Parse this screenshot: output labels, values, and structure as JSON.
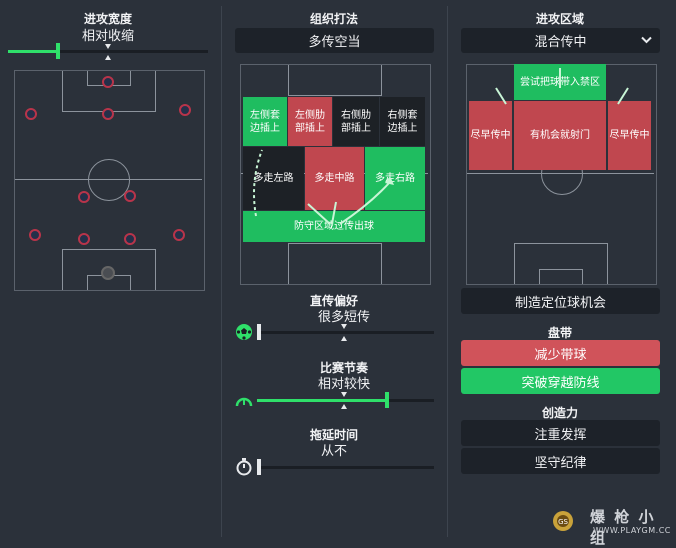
{
  "left": {
    "width_title": "进攻宽度",
    "width_value": "相对收缩",
    "width_level": 0.25
  },
  "mid": {
    "org_title": "组织打法",
    "org_value": "多传空当",
    "zones": {
      "top_left": "左侧套\n边插上",
      "top_lcm": "左侧肋\n部插上",
      "top_rcm": "右侧肋\n部插上",
      "top_right": "右侧套\n边插上",
      "mid_left": "多走左路",
      "mid_center": "多走中路",
      "mid_right": "多走右路",
      "bottom": "防守区域过传出球"
    },
    "passing_title": "直传偏好",
    "passing_value": "很多短传",
    "passing_level": 0.0,
    "tempo_title": "比赛节奏",
    "tempo_value": "相对较快",
    "tempo_level": 0.75,
    "timewaste_title": "拖延时间",
    "timewaste_value": "从不",
    "timewaste_level": 0.0
  },
  "right": {
    "area_title": "进攻区域",
    "area_value": "混合传中",
    "zones": {
      "box": "尝试把球带入禁区",
      "left": "尽早传中",
      "center": "有机会就射门",
      "right": "尽早传中"
    },
    "setpiece_label": "制造定位球机会",
    "dribble_title": "盘带",
    "dribble_opt1": "减少带球",
    "dribble_opt2": "突破穿越防线",
    "creative_title": "创造力",
    "creative_opt1": "注重发挥",
    "creative_opt2": "坚守纪律"
  },
  "watermark": {
    "cn": "爆 枪 小 组",
    "en": "WWW.PLAYGM.CC",
    "logo": "GS"
  },
  "colors": {
    "accent_green": "#2fe06a",
    "zone_green": "#1fbd60",
    "zone_red": "#c0474f",
    "btn_red": "#d0535a",
    "btn_green": "#22c765"
  }
}
